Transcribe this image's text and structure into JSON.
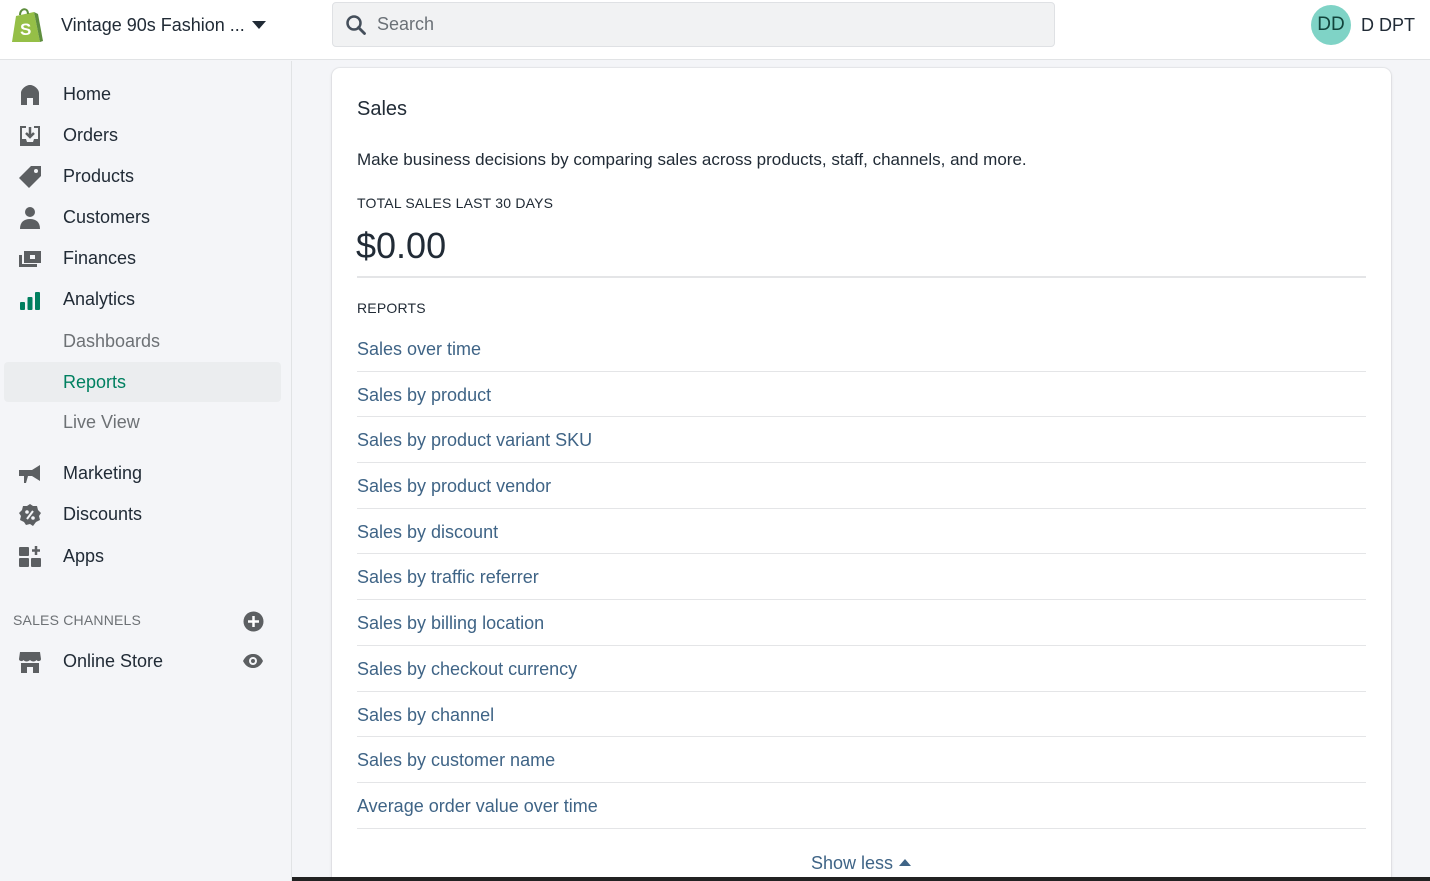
{
  "topbar": {
    "store_name": "Vintage 90s Fashion ...",
    "search_placeholder": "Search",
    "user_initials": "DD",
    "user_name": "D DPT"
  },
  "sidebar": {
    "items": [
      {
        "label": "Home",
        "icon": "home-icon"
      },
      {
        "label": "Orders",
        "icon": "orders-icon"
      },
      {
        "label": "Products",
        "icon": "tag-icon"
      },
      {
        "label": "Customers",
        "icon": "person-icon"
      },
      {
        "label": "Finances",
        "icon": "finances-icon"
      },
      {
        "label": "Analytics",
        "icon": "bar-chart-icon"
      }
    ],
    "analytics_sub": [
      {
        "label": "Dashboards"
      },
      {
        "label": "Reports",
        "active": true
      },
      {
        "label": "Live View"
      }
    ],
    "items2": [
      {
        "label": "Marketing",
        "icon": "megaphone-icon"
      },
      {
        "label": "Discounts",
        "icon": "discount-icon"
      },
      {
        "label": "Apps",
        "icon": "apps-icon"
      }
    ],
    "sales_channels_title": "SALES CHANNELS",
    "online_store": "Online Store"
  },
  "main": {
    "card_title": "Sales",
    "description": "Make business decisions by comparing sales across products, staff, channels, and more.",
    "total_label": "TOTAL SALES LAST 30 DAYS",
    "total_value": "$0.00",
    "reports_label": "REPORTS",
    "reports": [
      "Sales over time",
      "Sales by product",
      "Sales by product variant SKU",
      "Sales by product vendor",
      "Sales by discount",
      "Sales by traffic referrer",
      "Sales by billing location",
      "Sales by checkout currency",
      "Sales by channel",
      "Sales by customer name",
      "Average order value over time"
    ],
    "show_less": "Show less"
  },
  "colors": {
    "accent_green": "#008060",
    "link_blue": "#3f6486",
    "avatar_bg": "#7fd3c6"
  }
}
